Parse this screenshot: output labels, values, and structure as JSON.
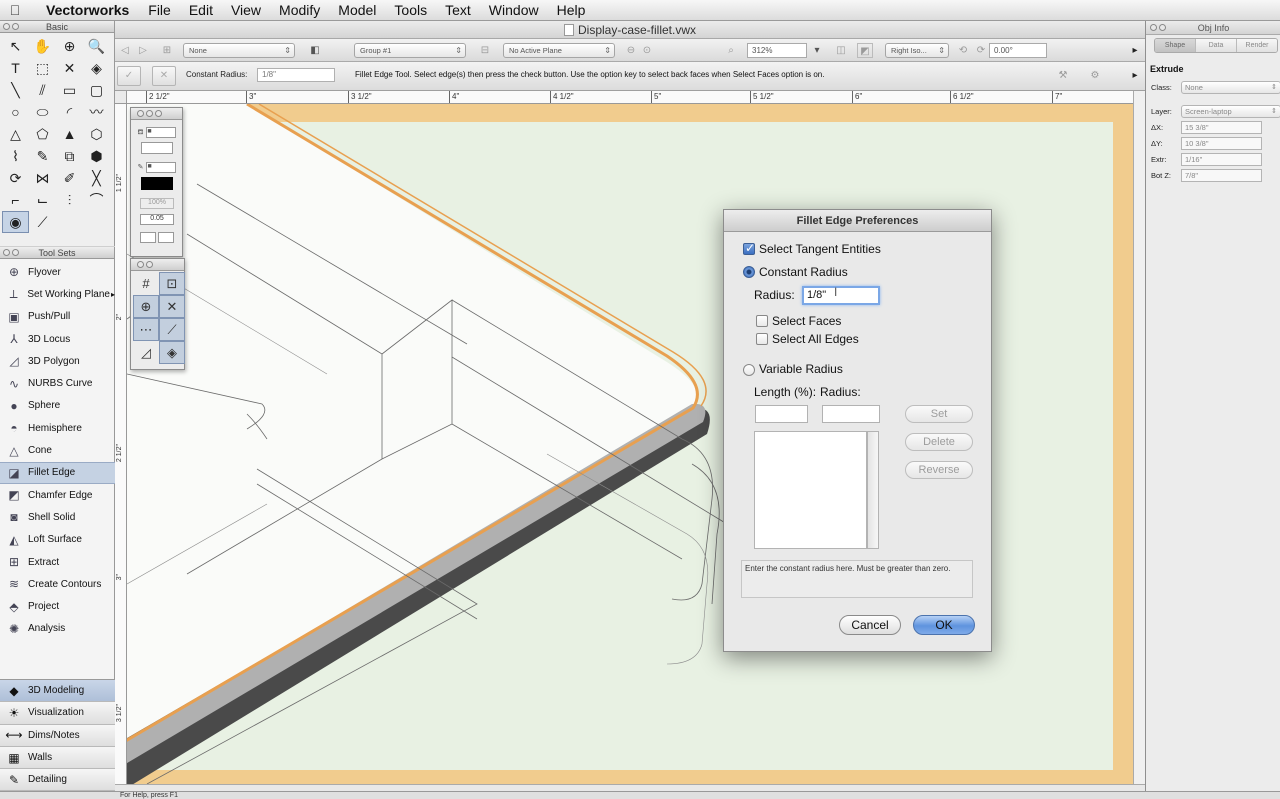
{
  "menubar": {
    "app_name": "Vectorworks",
    "items": [
      "File",
      "Edit",
      "View",
      "Modify",
      "Model",
      "Tools",
      "Text",
      "Window",
      "Help"
    ]
  },
  "document": {
    "title": "Display-case-fillet.vwx"
  },
  "view_bar": {
    "class_dd": "None",
    "layer_dd": "Group #1",
    "plane_dd": "No Active Plane",
    "zoom": "312%",
    "view_dd": "Right Iso...",
    "rotation": "0.00°"
  },
  "mode_bar": {
    "constant_radius_label": "Constant Radius:",
    "constant_radius_value": "1/8\"",
    "help_text": "Fillet Edge Tool. Select edge(s) then press the check button. Use the option key to select back faces when Select Faces option is on."
  },
  "rulers": {
    "horizontal": [
      "2 1/2\"",
      "3\"",
      "3 1/2\"",
      "4\"",
      "4 1/2\"",
      "5\"",
      "5 1/2\"",
      "6\"",
      "6 1/2\"",
      "7\""
    ],
    "vertical": [
      "1 1/2\"",
      "2\"",
      "2 1/2\"",
      "3\"",
      "3 1/2\""
    ]
  },
  "basic_palette": {
    "title": "Basic",
    "tools": [
      {
        "icon": "arrow-icon",
        "glyph": "↖"
      },
      {
        "icon": "pan-icon",
        "glyph": "✋"
      },
      {
        "icon": "flyover-icon",
        "glyph": "⊕"
      },
      {
        "icon": "zoom-icon",
        "glyph": "🔍"
      },
      {
        "icon": "text-icon",
        "glyph": "T"
      },
      {
        "icon": "selection-rect-icon",
        "glyph": "⬚"
      },
      {
        "icon": "x-icon",
        "glyph": "✕"
      },
      {
        "icon": "attribute-icon",
        "glyph": "◈"
      },
      {
        "icon": "line-icon",
        "glyph": "╲"
      },
      {
        "icon": "double-line-icon",
        "glyph": "⫽"
      },
      {
        "icon": "rectangle-icon",
        "glyph": "▭"
      },
      {
        "icon": "rounded-rect-icon",
        "glyph": "▢"
      },
      {
        "icon": "circle-icon",
        "glyph": "○"
      },
      {
        "icon": "oval-icon",
        "glyph": "⬭"
      },
      {
        "icon": "arc-icon",
        "glyph": "◜"
      },
      {
        "icon": "freehand-icon",
        "glyph": "〰"
      },
      {
        "icon": "polyline-icon",
        "glyph": "△"
      },
      {
        "icon": "polygon-icon",
        "glyph": "⬠"
      },
      {
        "icon": "triangle-icon",
        "glyph": "▲"
      },
      {
        "icon": "hexagon-icon",
        "glyph": "⬡"
      },
      {
        "icon": "spiral-icon",
        "glyph": "⌇"
      },
      {
        "icon": "eyedropper-icon",
        "glyph": "✎"
      },
      {
        "icon": "offset-icon",
        "glyph": "⧉"
      },
      {
        "icon": "shape-icon",
        "glyph": "⬢"
      },
      {
        "icon": "rotate-icon",
        "glyph": "⟳"
      },
      {
        "icon": "mirror-icon",
        "glyph": "⋈"
      },
      {
        "icon": "reshape-icon",
        "glyph": "✐"
      },
      {
        "icon": "trim-icon",
        "glyph": "╳"
      },
      {
        "icon": "fillet-2d-icon",
        "glyph": "⌐"
      },
      {
        "icon": "chamfer-2d-icon",
        "glyph": "⌙"
      },
      {
        "icon": "split-icon",
        "glyph": "⫶"
      },
      {
        "icon": "connect-icon",
        "glyph": "⌒"
      },
      {
        "icon": "visibility-icon",
        "glyph": "◉"
      },
      {
        "icon": "dimension-icon",
        "glyph": "⟋"
      },
      {
        "icon": "",
        "glyph": ""
      },
      {
        "icon": "",
        "glyph": ""
      }
    ]
  },
  "tool_sets": {
    "title": "Tool Sets",
    "items": [
      {
        "label": "Flyover",
        "icon": "flyover-icon",
        "glyph": "⊕"
      },
      {
        "label": "Set Working Plane",
        "icon": "working-plane-icon",
        "glyph": "⟂",
        "flyout": "▸"
      },
      {
        "label": "Push/Pull",
        "icon": "push-pull-icon",
        "glyph": "▣"
      },
      {
        "label": "3D Locus",
        "icon": "locus-3d-icon",
        "glyph": "⅄"
      },
      {
        "label": "3D Polygon",
        "icon": "polygon-3d-icon",
        "glyph": "◿"
      },
      {
        "label": "NURBS Curve",
        "icon": "nurbs-curve-icon",
        "glyph": "∿"
      },
      {
        "label": "Sphere",
        "icon": "sphere-icon",
        "glyph": "●"
      },
      {
        "label": "Hemisphere",
        "icon": "hemisphere-icon",
        "glyph": "◓"
      },
      {
        "label": "Cone",
        "icon": "cone-icon",
        "glyph": "△"
      },
      {
        "label": "Fillet Edge",
        "icon": "fillet-edge-icon",
        "glyph": "◪"
      },
      {
        "label": "Chamfer Edge",
        "icon": "chamfer-edge-icon",
        "glyph": "◩"
      },
      {
        "label": "Shell Solid",
        "icon": "shell-solid-icon",
        "glyph": "◙"
      },
      {
        "label": "Loft Surface",
        "icon": "loft-surface-icon",
        "glyph": "◭"
      },
      {
        "label": "Extract",
        "icon": "extract-icon",
        "glyph": "⊞"
      },
      {
        "label": "Create Contours",
        "icon": "contours-icon",
        "glyph": "≋"
      },
      {
        "label": "Project",
        "icon": "project-icon",
        "glyph": "⬘"
      },
      {
        "label": "Analysis",
        "icon": "analysis-icon",
        "glyph": "✺"
      }
    ],
    "selected_index": 9,
    "sets": [
      {
        "label": "3D Modeling",
        "icon": "modeling-3d-icon",
        "glyph": "◆"
      },
      {
        "label": "Visualization",
        "icon": "visualization-icon",
        "glyph": "☀"
      },
      {
        "label": "Dims/Notes",
        "icon": "dims-notes-icon",
        "glyph": "⟷"
      },
      {
        "label": "Walls",
        "icon": "walls-icon",
        "glyph": "▦"
      },
      {
        "label": "Detailing",
        "icon": "detailing-icon",
        "glyph": "✎"
      }
    ]
  },
  "attributes_palette": {
    "opacity": "100%",
    "line_weight": "0.05"
  },
  "obj_info": {
    "title": "Obj Info",
    "tabs": [
      "Shape",
      "Data",
      "Render"
    ],
    "object_type": "Extrude",
    "fields": [
      {
        "label": "Class:",
        "value": "None",
        "dropdown": true
      },
      {
        "label": "Layer:",
        "value": "Screen-laptop",
        "dropdown": true
      },
      {
        "label": "ΔX:",
        "value": "15 3/8\""
      },
      {
        "label": "ΔY:",
        "value": "10 3/8\""
      },
      {
        "label": "Extr:",
        "value": "1/16\""
      },
      {
        "label": "Bot Z:",
        "value": "7/8\""
      }
    ]
  },
  "fillet_dialog": {
    "title": "Fillet Edge Preferences",
    "select_tangent_label": "Select Tangent Entities",
    "select_tangent_checked": true,
    "constant_radius_label": "Constant Radius",
    "constant_radius_selected": true,
    "radius_label": "Radius:",
    "radius_value": "1/8\"",
    "select_faces_label": "Select Faces",
    "select_faces_checked": false,
    "select_all_edges_label": "Select All Edges",
    "select_all_edges_checked": false,
    "variable_radius_label": "Variable Radius",
    "variable_radius_selected": false,
    "length_label": "Length (%):",
    "var_radius_label": "Radius:",
    "set_label": "Set",
    "delete_label": "Delete",
    "reverse_label": "Reverse",
    "help_text": "Enter the constant radius here. Must be greater than zero.",
    "cancel_label": "Cancel",
    "ok_label": "OK"
  },
  "status": {
    "text": "For Help, press F1"
  },
  "colors": {
    "canvas_border": "#f1cc8e",
    "canvas_fill": "#e8f1e3",
    "accent": "#3b6fc1",
    "edge_highlight": "#e8a050"
  }
}
